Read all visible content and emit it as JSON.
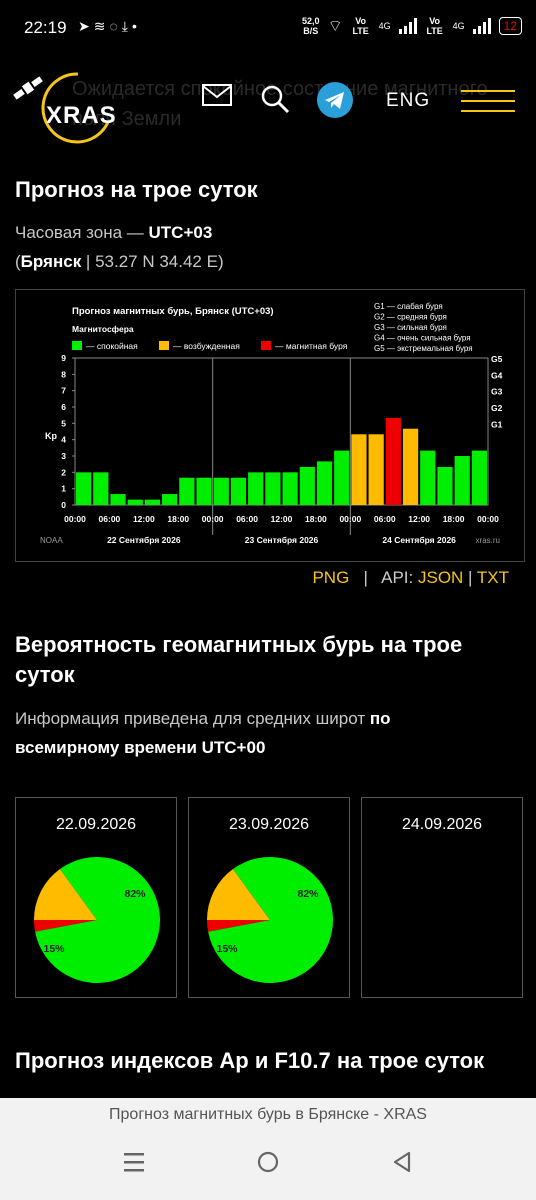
{
  "status_bar": {
    "time": "22:19",
    "speed_value": "52,0",
    "speed_unit": "B/S",
    "net1": "Vo LTE",
    "net2": "Vo LTE",
    "gen1": "4G",
    "gen2": "4G",
    "battery": "12"
  },
  "header": {
    "logo_text": "XRAS",
    "ghost_text": "Ожидается спокойное состояние магнитного поля Земли",
    "lang_label": "ENG",
    "icons": [
      "mail-icon",
      "search-icon",
      "telegram-icon",
      "menu-icon"
    ]
  },
  "forecast": {
    "title": "Прогноз на трое суток",
    "tz_label": "Часовая зона —",
    "tz_value": "UTC+03",
    "city": "Брянск",
    "coords": "53.27 N 34.42 E",
    "links": {
      "png": "PNG",
      "api_label": "API:",
      "json": "JSON",
      "txt": "TXT"
    }
  },
  "chart_data": {
    "type": "bar",
    "title": "Прогноз магнитных бурь, Брянск (UTC+03)",
    "subtitle": "Магнитосфера",
    "legend": [
      {
        "label": "— спокойная",
        "color": "#00ee00"
      },
      {
        "label": "— возбужденная",
        "color": "#ffbb00"
      },
      {
        "label": "— магнитная буря",
        "color": "#ee0000"
      }
    ],
    "g_legend": [
      "G1 — слабая буря",
      "G2 — средняя буря",
      "G3 — сильная буря",
      "G4 — очень сильная буря",
      "G5 — экстремальная буря"
    ],
    "ylabel": "Kp",
    "ylim": [
      0,
      9
    ],
    "yticks": [
      "0",
      "1",
      "2",
      "3",
      "4",
      "5",
      "6",
      "7",
      "8",
      "9"
    ],
    "g_ticks": [
      {
        "label": "G1",
        "kp": 5
      },
      {
        "label": "G2",
        "kp": 6
      },
      {
        "label": "G3",
        "kp": 7
      },
      {
        "label": "G4",
        "kp": 8
      },
      {
        "label": "G5",
        "kp": 9
      }
    ],
    "xticks": [
      "00:00",
      "06:00",
      "12:00",
      "18:00",
      "00:00",
      "06:00",
      "12:00",
      "18:00",
      "00:00",
      "06:00",
      "12:00",
      "18:00",
      "00:00"
    ],
    "days": [
      "22 Сентября 2026",
      "23 Сентября 2026",
      "24 Сентября 2026"
    ],
    "source_left": "NOAA",
    "source_right": "xras.ru",
    "values": [
      2.0,
      2.0,
      0.67,
      0.33,
      0.33,
      0.67,
      1.67,
      1.67,
      1.67,
      1.67,
      2.0,
      2.0,
      2.0,
      2.33,
      2.67,
      3.33,
      4.33,
      4.33,
      5.33,
      4.67,
      3.33,
      2.33,
      3.0,
      3.33
    ],
    "colors": [
      "g",
      "g",
      "g",
      "g",
      "g",
      "g",
      "g",
      "g",
      "g",
      "g",
      "g",
      "g",
      "g",
      "g",
      "g",
      "g",
      "o",
      "o",
      "r",
      "o",
      "g",
      "g",
      "g",
      "g"
    ]
  },
  "probability": {
    "title_line1": "Вероятность геомагнитных бурь на трое",
    "title_line2": "суток",
    "info_line1_text": "Информация приведена для средних широт",
    "info_line1_bold": "по",
    "info_line2_bold": "всемирному времени UTC+00",
    "cards": [
      {
        "date": "22.09.2026",
        "green": 82,
        "orange": 15,
        "red": 3,
        "green_label": "82%",
        "orange_label": "15%"
      },
      {
        "date": "23.09.2026",
        "green": 82,
        "orange": 15,
        "red": 3,
        "green_label": "82%",
        "orange_label": "15%"
      },
      {
        "date": "24.09.2026"
      }
    ]
  },
  "indices": {
    "title": "Прогноз индексов Ap и F10.7 на трое суток"
  },
  "browser": {
    "page_title": "Прогноз магнитных бурь в Брянске - XRAS"
  },
  "colors": {
    "accent": "#f5c518",
    "quiet": "#00ee00",
    "active": "#ffbb00",
    "storm": "#ee0000"
  }
}
